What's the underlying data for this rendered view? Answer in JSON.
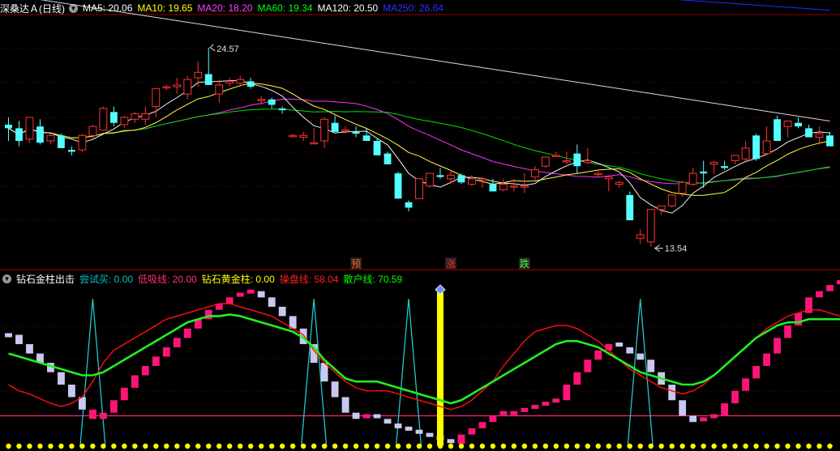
{
  "header_top": {
    "title": "深桑达Ａ(日线)",
    "items": [
      {
        "label": "MA5: 20.06",
        "color": "#ffffff"
      },
      {
        "label": "MA10: 19.65",
        "color": "#ffff00"
      },
      {
        "label": "MA20: 18.20",
        "color": "#ff40ff"
      },
      {
        "label": "MA60: 19.34",
        "color": "#00ff00"
      },
      {
        "label": "MA120: 20.50",
        "color": "#ffffff"
      },
      {
        "label": "MA250: 26.64",
        "color": "#3030ff"
      }
    ]
  },
  "header_bottom": {
    "title": "钻石金柱出击",
    "items": [
      {
        "label": "尝试买: 0.00",
        "color": "#00c0c0"
      },
      {
        "label": "低吸线: 20.00",
        "color": "#ff3080"
      },
      {
        "label": "钻石黄金柱: 0.00",
        "color": "#ffff00"
      },
      {
        "label": "操盘线: 58.04",
        "color": "#ff2020"
      },
      {
        "label": "散户线: 70.59",
        "color": "#00ff00"
      }
    ]
  },
  "chart_data": [
    {
      "type": "candlestick",
      "ylim": [
        12.4,
        26.4
      ],
      "price_high_label": "24.57",
      "price_low_label": "13.54",
      "ohlc": [
        [
          20.3,
          20.7,
          19.4,
          20.1
        ],
        [
          20.1,
          20.5,
          19.1,
          19.4
        ],
        [
          19.5,
          20.7,
          19.3,
          20.7
        ],
        [
          20.2,
          20.6,
          19.2,
          19.3
        ],
        [
          19.4,
          19.8,
          19.2,
          19.7
        ],
        [
          19.7,
          19.8,
          19.0,
          19.0
        ],
        [
          18.9,
          19.1,
          18.6,
          18.8
        ],
        [
          18.9,
          19.8,
          18.8,
          19.7
        ],
        [
          19.7,
          20.3,
          19.5,
          20.2
        ],
        [
          20.0,
          21.3,
          20.0,
          21.2
        ],
        [
          21.0,
          21.3,
          20.2,
          20.4
        ],
        [
          20.3,
          20.8,
          20.1,
          20.7
        ],
        [
          20.6,
          21.0,
          20.4,
          20.9
        ],
        [
          20.6,
          21.3,
          20.3,
          20.9
        ],
        [
          21.3,
          22.3,
          20.7,
          22.3
        ],
        [
          22.4,
          22.5,
          22.2,
          22.4
        ],
        [
          22.4,
          22.9,
          22.0,
          22.5
        ],
        [
          22.0,
          23.0,
          21.7,
          22.8
        ],
        [
          22.9,
          23.8,
          22.4,
          23.2
        ],
        [
          23.1,
          24.57,
          22.5,
          22.5
        ],
        [
          22.0,
          22.8,
          21.5,
          22.5
        ],
        [
          22.6,
          22.9,
          22.4,
          22.7
        ],
        [
          22.6,
          23.0,
          22.4,
          22.8
        ],
        [
          22.7,
          22.9,
          22.3,
          22.4
        ],
        [
          21.7,
          21.9,
          21.4,
          21.7
        ],
        [
          21.7,
          21.8,
          21.2,
          21.4
        ],
        [
          21.2,
          21.3,
          20.9,
          21.1
        ],
        [
          19.7,
          19.8,
          19.6,
          19.7
        ],
        [
          19.6,
          19.9,
          19.4,
          19.7
        ],
        [
          19.3,
          20.1,
          19.3,
          19.3
        ],
        [
          19.4,
          20.7,
          19.0,
          20.6
        ],
        [
          20.4,
          20.8,
          20.0,
          19.9
        ],
        [
          20.0,
          20.2,
          19.8,
          20.0
        ],
        [
          19.9,
          20.2,
          19.6,
          19.8
        ],
        [
          19.7,
          20.1,
          19.4,
          19.4
        ],
        [
          19.4,
          19.5,
          18.6,
          18.6
        ],
        [
          18.7,
          18.8,
          18.5,
          18.1
        ],
        [
          17.6,
          17.7,
          16.2,
          16.2
        ],
        [
          16.0,
          16.1,
          15.5,
          15.7
        ],
        [
          16.2,
          17.3,
          16.2,
          17.3
        ],
        [
          16.9,
          17.6,
          16.8,
          17.6
        ],
        [
          17.5,
          17.9,
          17.3,
          17.4
        ],
        [
          17.3,
          17.8,
          17.0,
          17.5
        ],
        [
          17.5,
          17.6,
          17.0,
          17.1
        ],
        [
          17.0,
          17.5,
          16.9,
          17.3
        ],
        [
          17.3,
          17.4,
          16.8,
          17.3
        ],
        [
          17.0,
          17.3,
          16.9,
          16.6
        ],
        [
          16.7,
          17.3,
          16.6,
          17.0
        ],
        [
          16.9,
          17.3,
          16.6,
          16.9
        ],
        [
          16.9,
          17.6,
          16.5,
          16.9
        ],
        [
          17.4,
          18.0,
          17.2,
          17.8
        ],
        [
          18.0,
          18.5,
          17.9,
          18.5
        ],
        [
          18.6,
          18.8,
          18.5,
          18.6
        ],
        [
          18.3,
          18.8,
          18.1,
          18.3
        ],
        [
          18.7,
          19.2,
          17.6,
          18.0
        ],
        [
          18.2,
          19.0,
          18.1,
          18.3
        ],
        [
          17.6,
          17.8,
          17.4,
          17.6
        ],
        [
          17.3,
          17.5,
          16.6,
          17.4
        ],
        [
          17.0,
          17.2,
          16.8,
          17.1
        ],
        [
          16.4,
          16.6,
          15.0,
          15.0
        ],
        [
          14.0,
          14.5,
          13.7,
          14.2
        ],
        [
          13.8,
          14.6,
          13.54,
          15.6
        ],
        [
          15.6,
          15.8,
          15.3,
          15.8
        ],
        [
          15.8,
          16.3,
          15.7,
          16.4
        ],
        [
          16.5,
          17.2,
          16.3,
          17.1
        ],
        [
          17.0,
          17.9,
          16.9,
          17.6
        ],
        [
          17.7,
          18.3,
          16.8,
          17.6
        ],
        [
          18.1,
          18.3,
          17.6,
          18.2
        ],
        [
          18.0,
          18.3,
          17.8,
          17.9
        ],
        [
          18.3,
          18.6,
          18.1,
          18.6
        ],
        [
          18.4,
          19.4,
          18.3,
          19.0
        ],
        [
          19.7,
          19.8,
          18.3,
          18.4
        ],
        [
          18.7,
          20.2,
          18.6,
          19.4
        ],
        [
          20.6,
          20.8,
          19.5,
          19.4
        ],
        [
          20.2,
          20.4,
          19.6,
          20.5
        ],
        [
          20.4,
          20.7,
          20.1,
          20.2
        ],
        [
          20.1,
          20.3,
          19.8,
          19.6
        ],
        [
          19.6,
          20.2,
          19.2,
          19.8
        ],
        [
          19.7,
          19.9,
          19.1,
          19.1
        ]
      ],
      "markers": [
        {
          "index": 33,
          "label": "预",
          "color": "#ff6020"
        },
        {
          "index": 42,
          "label": "涨",
          "color": "#ff2020"
        },
        {
          "index": 49,
          "label": "跌",
          "color": "#40ff40"
        }
      ]
    },
    {
      "type": "indicator",
      "ylim": [
        0,
        105
      ],
      "low_line_value": 20,
      "bars": [
        72,
        66,
        60,
        54,
        48,
        40,
        32,
        24,
        18,
        22,
        30,
        38,
        46,
        52,
        58,
        64,
        70,
        76,
        82,
        88,
        92,
        96,
        98,
        100,
        96,
        90,
        84,
        76,
        66,
        54,
        42,
        32,
        22,
        18,
        20,
        18,
        15,
        12,
        10,
        8,
        6,
        4,
        2,
        8,
        12,
        16,
        20,
        22,
        22,
        24,
        26,
        28,
        30,
        40,
        48,
        56,
        62,
        66,
        64,
        60,
        56,
        48,
        40,
        30,
        20,
        16,
        18,
        20,
        28,
        36,
        44,
        52,
        60,
        70,
        78,
        86,
        96,
        100,
        104,
        106,
        104,
        100,
        96,
        90
      ],
      "trend": [
        "down",
        "down",
        "down",
        "down",
        "down",
        "down",
        "down",
        "down",
        "up",
        "up",
        "up",
        "up",
        "up",
        "up",
        "up",
        "up",
        "up",
        "up",
        "up",
        "up",
        "up",
        "up",
        "up",
        "up",
        "down",
        "down",
        "down",
        "down",
        "down",
        "down",
        "down",
        "down",
        "down",
        "down",
        "up",
        "down",
        "down",
        "down",
        "down",
        "down",
        "down",
        "down",
        "down",
        "up",
        "up",
        "up",
        "up",
        "up",
        "up",
        "up",
        "up",
        "up",
        "up",
        "up",
        "up",
        "up",
        "up",
        "up",
        "down",
        "down",
        "down",
        "down",
        "down",
        "down",
        "down",
        "down",
        "up",
        "up",
        "up",
        "up",
        "up",
        "up",
        "up",
        "up",
        "up",
        "up",
        "up",
        "up",
        "up",
        "up",
        "down",
        "down",
        "down",
        "down"
      ],
      "operator_line": [
        40,
        36,
        34,
        31,
        28,
        26,
        28,
        32,
        42,
        54,
        62,
        66,
        70,
        74,
        78,
        82,
        84,
        86,
        88,
        90,
        92,
        92,
        90,
        88,
        86,
        84,
        80,
        76,
        72,
        62,
        54,
        48,
        42,
        38,
        36,
        36,
        36,
        34,
        32,
        30,
        28,
        26,
        24,
        26,
        30,
        36,
        42,
        52,
        60,
        68,
        74,
        76,
        78,
        78,
        76,
        72,
        68,
        62,
        56,
        50,
        46,
        42,
        38,
        36,
        34,
        36,
        40,
        46,
        52,
        58,
        64,
        70,
        76,
        80,
        84,
        86,
        88,
        88,
        86,
        84,
        86,
        84,
        78,
        72
      ],
      "retail_line": [
        60,
        58,
        56,
        54,
        52,
        50,
        48,
        46,
        46,
        48,
        52,
        56,
        60,
        64,
        68,
        72,
        76,
        80,
        82,
        84,
        84,
        85,
        84,
        82,
        80,
        78,
        76,
        74,
        70,
        64,
        56,
        50,
        44,
        42,
        42,
        42,
        40,
        38,
        36,
        34,
        32,
        30,
        28,
        30,
        34,
        38,
        42,
        46,
        50,
        54,
        58,
        62,
        66,
        68,
        68,
        66,
        64,
        60,
        56,
        52,
        48,
        46,
        44,
        42,
        40,
        40,
        42,
        46,
        52,
        58,
        64,
        70,
        74,
        78,
        80,
        80,
        82,
        82,
        82,
        82,
        80,
        78,
        76,
        70
      ],
      "spikes": [
        8,
        29,
        38,
        60
      ],
      "yellow_column_index": 41
    }
  ]
}
